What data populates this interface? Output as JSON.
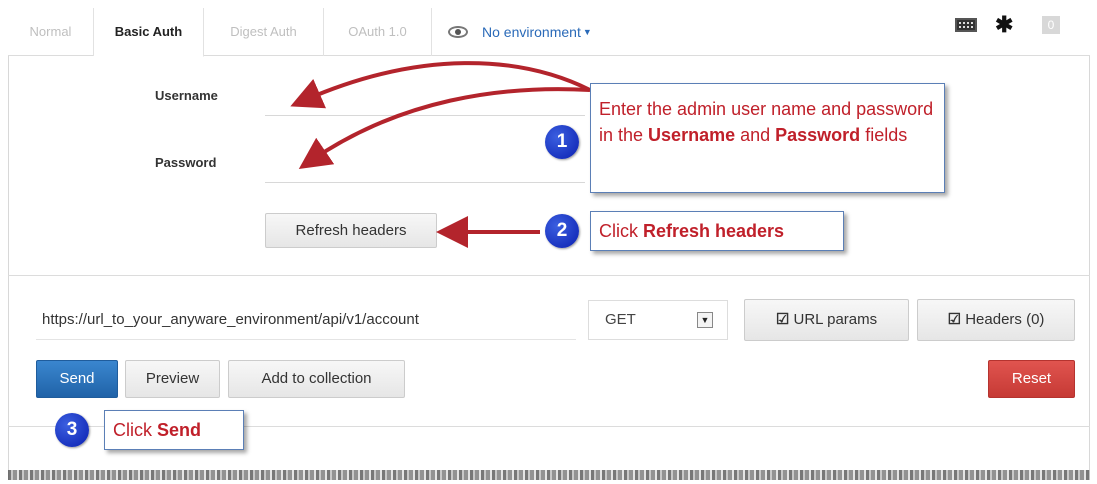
{
  "tabs": [
    {
      "label": "Normal",
      "active": false
    },
    {
      "label": "Basic Auth",
      "active": true
    },
    {
      "label": "Digest Auth",
      "active": false
    },
    {
      "label": "OAuth 1.0",
      "active": false
    }
  ],
  "environment": {
    "label": "No environment",
    "icon": "eye-icon"
  },
  "toolbar": {
    "keyboard_icon": "keyboard-icon",
    "tools_icon": "tools-icon",
    "badge": "0"
  },
  "auth": {
    "username_label": "Username",
    "password_label": "Password",
    "username_value": "",
    "password_value": "",
    "refresh_label": "Refresh headers"
  },
  "request": {
    "url": "https://url_to_your_anyware_environment/api/v1/account",
    "method": "GET",
    "url_params_label": "URL params",
    "headers_label": "Headers (0)"
  },
  "actions": {
    "send_label": "Send",
    "preview_label": "Preview",
    "add_collection_label": "Add to collection",
    "reset_label": "Reset"
  },
  "annotations": {
    "step1": {
      "number": "1",
      "text_a": "Enter the admin user name and password in the ",
      "bold_a": "Username",
      "text_b": " and ",
      "bold_b": "Password",
      "text_c": " fields"
    },
    "step2": {
      "number": "2",
      "text": "Click ",
      "bold": "Refresh headers"
    },
    "step3": {
      "number": "3",
      "text": "Click ",
      "bold": "Send"
    }
  },
  "colors": {
    "accent": "#2a6ab8",
    "send": "#2063a8",
    "reset": "#c63a35",
    "callout_text": "#c0202a",
    "arrow": "#b3242c"
  }
}
